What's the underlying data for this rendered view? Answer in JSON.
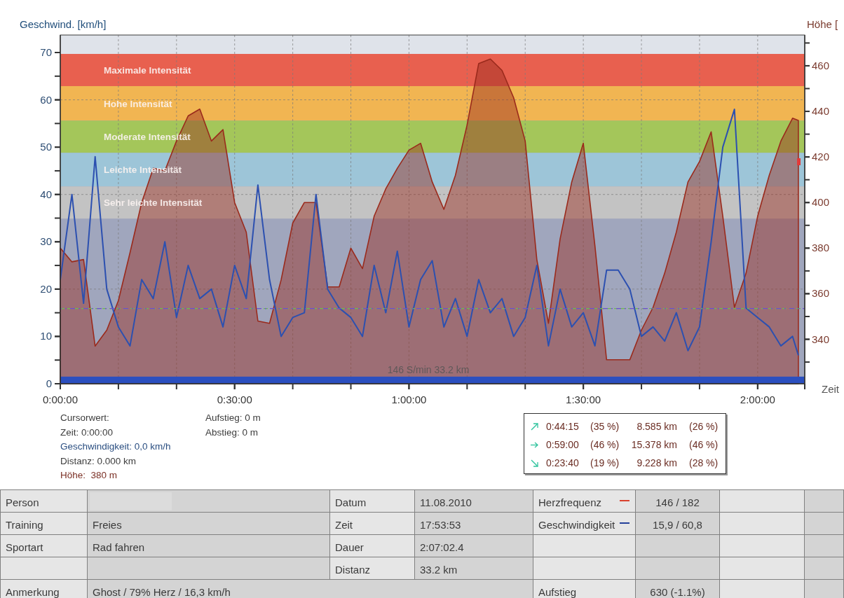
{
  "chart": {
    "chart_data": {
      "type": "line",
      "ylabel": "Geschwind. [km/h]",
      "y2label": "Höhe [",
      "xlabel": "Zeit",
      "xlim": [
        0,
        128.1
      ],
      "ylim": [
        0,
        73.7
      ],
      "y2lim": [
        320.5,
        473.5
      ],
      "grid": true,
      "xticks": [
        {
          "value": 0,
          "label": "0:00:00"
        },
        {
          "value": 30,
          "label": "0:30:00"
        },
        {
          "value": 60,
          "label": "1:00:00"
        },
        {
          "value": 90,
          "label": "1:30:00"
        },
        {
          "value": 120,
          "label": "2:00:00"
        }
      ],
      "yticks": [
        0,
        10,
        20,
        30,
        40,
        50,
        60,
        70
      ],
      "y2ticks": [
        340,
        360,
        380,
        400,
        420,
        440,
        460
      ],
      "x": [
        0,
        2,
        4,
        6,
        8,
        10,
        12,
        14,
        16,
        18,
        20,
        22,
        24,
        26,
        28,
        30,
        32,
        34,
        36,
        38,
        40,
        42,
        44,
        46,
        48,
        50,
        52,
        54,
        56,
        58,
        60,
        62,
        64,
        66,
        68,
        70,
        72,
        74,
        76,
        78,
        80,
        82,
        84,
        86,
        88,
        90,
        92,
        94,
        96,
        98,
        100,
        102,
        104,
        106,
        108,
        110,
        112,
        114,
        116,
        118,
        120,
        122,
        124,
        126,
        127
      ],
      "series": [
        {
          "type": "area",
          "axis": "y2",
          "color": "#9a2a1c",
          "values": [
            380,
            374,
            375,
            337,
            344,
            357,
            378,
            400,
            415,
            414,
            427,
            438,
            441,
            427,
            432,
            400,
            387,
            348,
            347,
            366,
            391,
            400,
            400,
            363,
            363,
            380,
            371,
            394,
            406,
            415,
            423,
            426,
            409,
            397,
            412,
            434,
            461,
            463,
            458,
            446,
            427,
            375,
            347,
            384,
            409,
            426,
            381,
            331,
            331,
            331,
            344,
            354,
            369,
            387,
            409,
            418,
            431,
            394,
            354,
            369,
            394,
            412,
            427,
            437,
            436
          ]
        },
        {
          "color": "#2c50b0",
          "values": [
            22,
            40,
            17,
            48,
            20,
            12,
            8,
            22,
            18,
            30,
            14,
            25,
            18,
            20,
            12,
            25,
            18,
            42,
            22,
            10,
            14,
            15,
            40,
            20,
            16,
            14,
            10,
            25,
            15,
            28,
            12,
            22,
            26,
            12,
            18,
            10,
            22,
            15,
            18,
            10,
            14,
            25,
            8,
            20,
            12,
            15,
            8,
            24,
            24,
            20,
            10,
            12,
            9,
            15,
            7,
            12,
            30,
            50,
            58,
            16,
            14,
            12,
            8,
            10,
            6
          ]
        }
      ],
      "bands": [
        {
          "axis": "y",
          "label": "Maximale Intensität",
          "from": 62.9,
          "to": 69.7,
          "color": "#e8604f"
        },
        {
          "axis": "y",
          "label": "Hohe Intensität",
          "from": 55.6,
          "to": 62.9,
          "color": "#f1b552"
        },
        {
          "axis": "y",
          "label": "Moderate Intensität",
          "from": 48.8,
          "to": 55.6,
          "color": "#a4c65a"
        },
        {
          "axis": "y",
          "label": "Leichte Intensität",
          "from": 41.7,
          "to": 48.8,
          "color": "#9dc5d8"
        },
        {
          "axis": "y",
          "label": "Sehr leichte Intensität",
          "from": 34.9,
          "to": 41.7,
          "color": "#c3c3c3"
        },
        {
          "axis": "y",
          "from": 0,
          "to": 1.5,
          "color": "#2b4fbf"
        }
      ],
      "ref_lines": [
        {
          "axis": "y",
          "value": 15.9,
          "color": "#6cbf4a"
        },
        {
          "axis": "y",
          "value": 15.9,
          "color": "#6b4fd0"
        }
      ],
      "annotations": [
        "146 S/min 33.2 km"
      ]
    }
  },
  "cursor": {
    "lines": [
      {
        "text": "Cursorwert:",
        "color": "#3c3c3c"
      },
      {
        "text": "Zeit: 0:00:00",
        "color": "#3c3c3c"
      },
      {
        "text": "Geschwindigkeit: 0,0 km/h",
        "color": "#2a4e80"
      },
      {
        "text": "Distanz: 0.000 km",
        "color": "#3c3c3c"
      },
      {
        "text": "Höhe:  380 m",
        "color": "#7a2f24"
      }
    ],
    "climb": [
      "Aufstieg: 0 m",
      "Abstieg: 0 m"
    ]
  },
  "trend_summary": [
    {
      "kind": "up",
      "time": "0:44:15",
      "time_share": "(35 %)",
      "distance": "8.585 km",
      "distance_share": "(26 %)"
    },
    {
      "kind": "flat",
      "time": "0:59:00",
      "time_share": "(46 %)",
      "distance": "15.378 km",
      "distance_share": "(46 %)"
    },
    {
      "kind": "down",
      "time": "0:23:40",
      "time_share": "(19 %)",
      "distance": "9.228 km",
      "distance_share": "(28 %)"
    }
  ],
  "table": {
    "rows": [
      {
        "kind": "standard",
        "label": "Person",
        "value_redacted": true,
        "label_2": "Datum",
        "value_2": "11.08.2010",
        "label_3": "Herzfrequenz",
        "color": "#d9412e",
        "value_3": "146 / 182"
      },
      {
        "kind": "standard",
        "label": "Training",
        "value": "Freies",
        "label_2": "Zeit",
        "value_2": "17:53:53",
        "label_3": "Geschwindigkeit",
        "color": "#24409a",
        "value_3": "15,9 / 60,8"
      },
      {
        "kind": "standard",
        "label": "Sportart",
        "value": "Rad fahren",
        "label_2": "Dauer",
        "value_2": "2:07:02.4"
      },
      {
        "kind": "standard",
        "label_2": "Distanz",
        "value_2": "33.2 km"
      },
      {
        "kind": "note",
        "label": "Anmerkung",
        "value": "Ghost / 79% Herz / 16,3 km/h",
        "label_3": "Aufstieg",
        "value_3": "630 (-1.1%)"
      }
    ]
  }
}
